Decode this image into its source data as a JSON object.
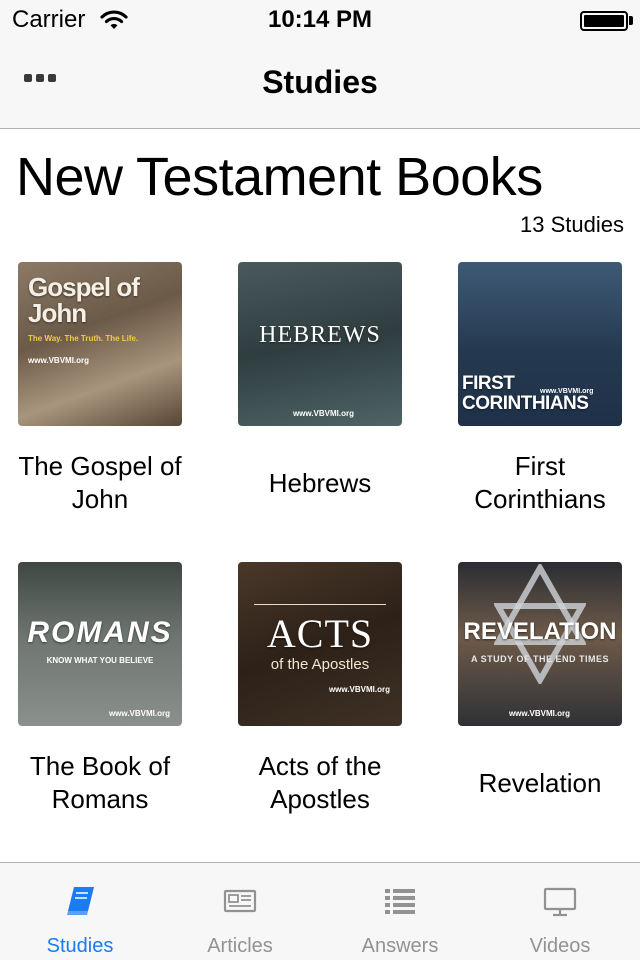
{
  "status_bar": {
    "carrier": "Carrier",
    "time": "10:14 PM",
    "battery_level": 1.0
  },
  "nav": {
    "title": "Studies",
    "more_icon": "more-dots-icon"
  },
  "section": {
    "title": "New Testament Books",
    "count": "13 Studies"
  },
  "studies": [
    {
      "label": "The Gospel of John",
      "cover_title": "Gospel of John",
      "cover_subtitle": "The Way. The Truth. The Life.",
      "cover_site": "www.VBVMI.org"
    },
    {
      "label": "Hebrews",
      "cover_title": "HEBREWS",
      "cover_site": "www.VBVMI.org"
    },
    {
      "label": "First Corinthians",
      "cover_title": "FIRST CORINTHIANS",
      "cover_site": "www.VBVMI.org"
    },
    {
      "label": "The Book of Romans",
      "cover_title": "ROMANS",
      "cover_subtitle": "KNOW WHAT YOU BELIEVE",
      "cover_site": "www.VBVMI.org"
    },
    {
      "label": "Acts of the Apostles",
      "cover_title": "ACTS",
      "cover_subtitle": "of the Apostles",
      "cover_site": "www.VBVMI.org"
    },
    {
      "label": "Revelation",
      "cover_title": "REVELATION",
      "cover_subtitle": "A STUDY OF THE END TIMES",
      "cover_site": "www.VBVMI.org"
    }
  ],
  "tabs": [
    {
      "label": "Studies",
      "icon": "book-icon",
      "active": true
    },
    {
      "label": "Articles",
      "icon": "newspaper-icon",
      "active": false
    },
    {
      "label": "Answers",
      "icon": "list-icon",
      "active": false
    },
    {
      "label": "Videos",
      "icon": "monitor-icon",
      "active": false
    }
  ],
  "colors": {
    "accent": "#1b7bf0",
    "inactive_tab": "#929292",
    "bar_background": "#f7f7f7"
  }
}
